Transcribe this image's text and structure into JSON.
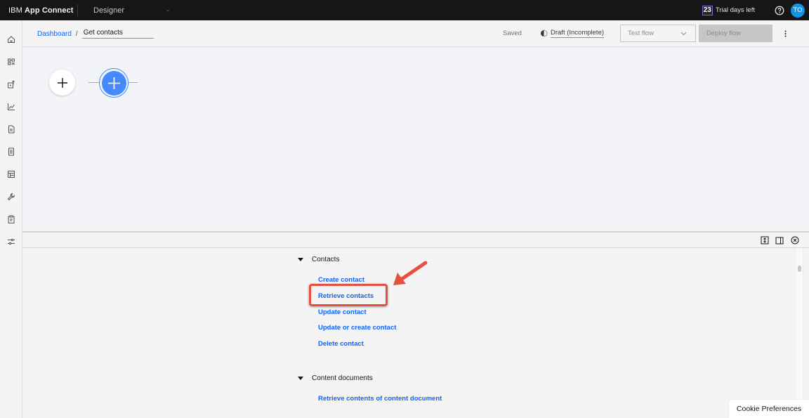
{
  "topbar": {
    "brand_prefix": "IBM",
    "brand_name": "App Connect",
    "app_switcher": "Designer",
    "trial_days": "23",
    "trial_label": "Trial days left",
    "avatar_initials": "TO"
  },
  "sidenav": {
    "items": [
      {
        "icon": "home-icon",
        "label": "Dashboard"
      },
      {
        "icon": "catalog-icon",
        "label": "Catalog"
      },
      {
        "icon": "import-icon",
        "label": "Import"
      },
      {
        "icon": "chart-icon",
        "label": "Monitoring"
      },
      {
        "icon": "document-icon",
        "label": "Documents"
      },
      {
        "icon": "list-icon",
        "label": "Logs"
      },
      {
        "icon": "template-icon",
        "label": "Templates"
      },
      {
        "icon": "wrench-icon",
        "label": "Tools"
      },
      {
        "icon": "clipboard-icon",
        "label": "Tasks"
      },
      {
        "icon": "settings-adjust-icon",
        "label": "Settings"
      }
    ]
  },
  "header": {
    "breadcrumb_root": "Dashboard",
    "breadcrumb_separator": "/",
    "flow_name": "Get contacts",
    "save_status": "Saved",
    "flow_status": "Draft (Incomplete)",
    "test_flow_label": "Test flow",
    "deploy_flow_label": "Deploy flow"
  },
  "panel": {
    "groups": [
      {
        "title": "Contacts",
        "actions": [
          "Create contact",
          "Retrieve contacts",
          "Update contact",
          "Update or create contact",
          "Delete contact"
        ]
      },
      {
        "title": "Content documents",
        "actions": [
          "Retrieve contents of content document"
        ]
      }
    ],
    "highlighted_action": "Retrieve contacts"
  },
  "cookie_label": "Cookie Preferences",
  "colors": {
    "accent": "#0f62fe",
    "node_active": "#4589ff",
    "annotation": "#e5503f",
    "topbar_bg": "#161616"
  }
}
